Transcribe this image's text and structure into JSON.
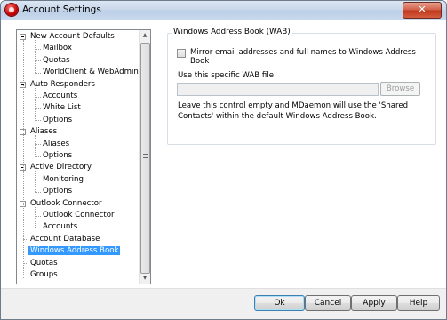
{
  "window": {
    "title": "Account Settings",
    "close_glyph": "✕"
  },
  "tree": {
    "items": [
      {
        "label": "New Account Defaults",
        "level": 0
      },
      {
        "label": "Mailbox",
        "level": 1
      },
      {
        "label": "Quotas",
        "level": 1
      },
      {
        "label": "WorldClient & WebAdmin",
        "level": 1
      },
      {
        "label": "Auto Responders",
        "level": 0
      },
      {
        "label": "Accounts",
        "level": 1
      },
      {
        "label": "White List",
        "level": 1
      },
      {
        "label": "Options",
        "level": 1
      },
      {
        "label": "Aliases",
        "level": 0
      },
      {
        "label": "Aliases",
        "level": 1
      },
      {
        "label": "Options",
        "level": 1
      },
      {
        "label": "Active Directory",
        "level": 0
      },
      {
        "label": "Monitoring",
        "level": 1
      },
      {
        "label": "Options",
        "level": 1
      },
      {
        "label": "Outlook Connector",
        "level": 0
      },
      {
        "label": "Outlook Connector",
        "level": 1
      },
      {
        "label": "Accounts",
        "level": 1
      },
      {
        "label": "Account Database",
        "level": 0
      },
      {
        "label": "Windows Address Book",
        "level": 0,
        "selected": true
      },
      {
        "label": "Quotas",
        "level": 0
      },
      {
        "label": "Groups",
        "level": 0
      }
    ]
  },
  "wab_group": {
    "title": "Windows Address Book (WAB)",
    "mirror_checkbox_label": "Mirror email addresses and full names to Windows Address Book",
    "mirror_checked": false,
    "wab_file_label": "Use this specific WAB file",
    "wab_file_value": "",
    "browse_label": "Browse",
    "help_text": "Leave this control empty and MDaemon will use the 'Shared Contacts' within the default Windows Address Book."
  },
  "buttons": {
    "ok": "Ok",
    "cancel": "Cancel",
    "apply": "Apply",
    "help": "Help"
  }
}
